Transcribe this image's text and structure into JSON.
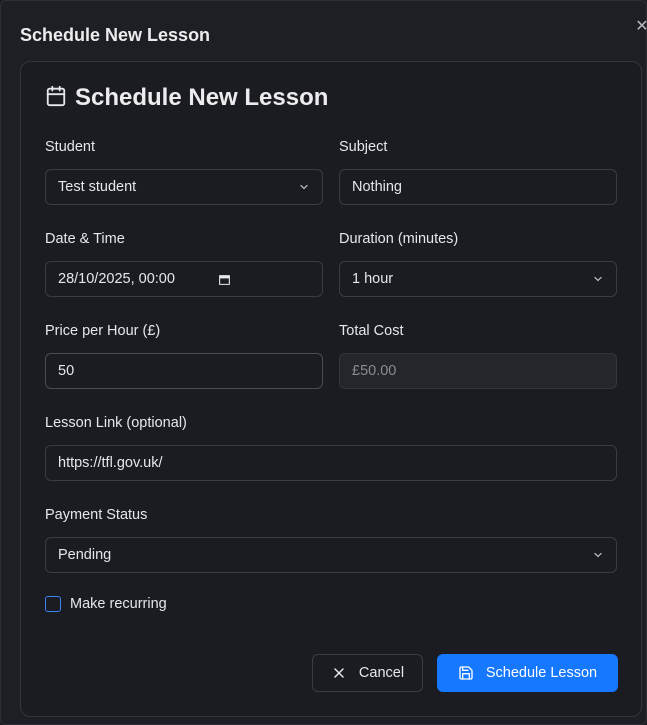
{
  "dialog": {
    "title": "Schedule New Lesson",
    "close_icon": "close-icon"
  },
  "card": {
    "title": "Schedule New Lesson",
    "icon": "calendar-icon"
  },
  "form": {
    "student": {
      "label": "Student",
      "value": "Test student"
    },
    "subject": {
      "label": "Subject",
      "value": "Nothing"
    },
    "datetime": {
      "label": "Date & Time",
      "value": "28/10/2025, 00:00"
    },
    "duration": {
      "label": "Duration (minutes)",
      "value": "1 hour"
    },
    "price": {
      "label": "Price per Hour (£)",
      "value": "50"
    },
    "total": {
      "label": "Total Cost",
      "value": "£50.00"
    },
    "link": {
      "label": "Lesson Link (optional)",
      "value": "https://tfl.gov.uk/"
    },
    "payment": {
      "label": "Payment Status",
      "value": "Pending"
    },
    "recurring": {
      "label": "Make recurring",
      "checked": false
    }
  },
  "buttons": {
    "cancel": "Cancel",
    "submit": "Schedule Lesson"
  },
  "colors": {
    "accent": "#1677ff",
    "background": "#1e1f24",
    "border": "#3a3c44"
  }
}
